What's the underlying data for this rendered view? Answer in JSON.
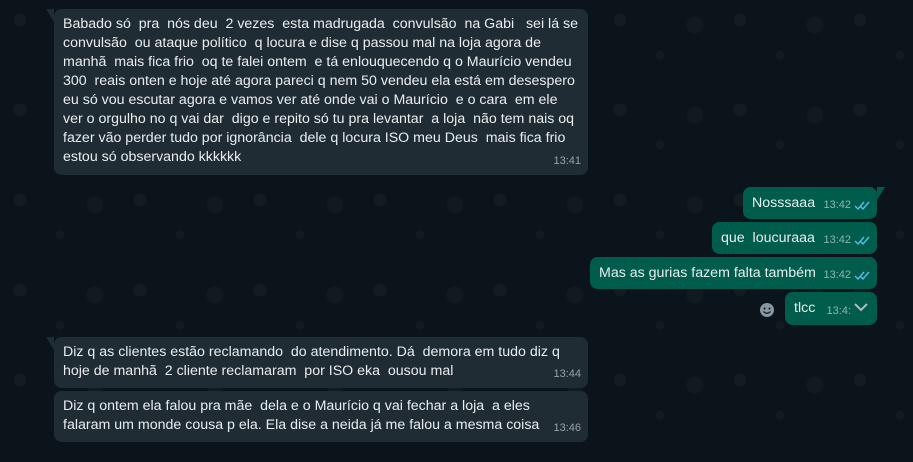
{
  "messages": [
    {
      "direction": "incoming",
      "text": "Babado só  pra  nós deu  2 vezes  esta madrugada  convulsão  na Gabi   sei lá se convulsão  ou ataque político  q locura e dise q passou mal na loja agora de manhã  mais fica frio  oq te falei ontem  e tá enlouquecendo q o Maurício vendeu 300  reais onten e hoje até agora pareci q nem 50 vendeu ela está em desespero eu só vou escutar agora e vamos ver até onde vai o Maurício  e o cara  em ele ver o orgulho no q vai dar  digo e repito só tu pra levantar  a loja  não tem nais oq fazer vão perder tudo por ignorância  dele q locura ISO meu Deus  mais fica frio estou só observando kkkkkk",
      "time": "13:41"
    },
    {
      "direction": "outgoing",
      "text": "Nosssaaa",
      "time": "13:42"
    },
    {
      "direction": "outgoing",
      "text": "que  loucuraaa",
      "time": "13:42"
    },
    {
      "direction": "outgoing",
      "text": "Mas as gurias fazem falta também",
      "time": "13:42"
    },
    {
      "direction": "outgoing",
      "text": "tlcc",
      "time": "13:4:"
    },
    {
      "direction": "incoming",
      "text": "Diz q as clientes estão reclamando  do atendimento. Dá  demora em tudo diz q hoje de manhã  2 cliente reclamaram  por ISO eka  ousou mal",
      "time": "13:44"
    },
    {
      "direction": "incoming",
      "text": "Diz q ontem ela falou pra mãe  dela e o Maurício q vai fechar a loja  a eles falaram um monde cousa p ela. Ela dise a neida já me falou a mesma coisa",
      "time": "13:46"
    }
  ],
  "icons": {
    "read_receipt": "double-check-icon",
    "emoji": "smiley-icon",
    "menu": "chevron-down-icon"
  },
  "colors": {
    "background": "#0b141a",
    "incoming_bubble": "#202c33",
    "outgoing_bubble": "#005c4b",
    "read_tick": "#53bdeb",
    "text": "#e9edef"
  }
}
